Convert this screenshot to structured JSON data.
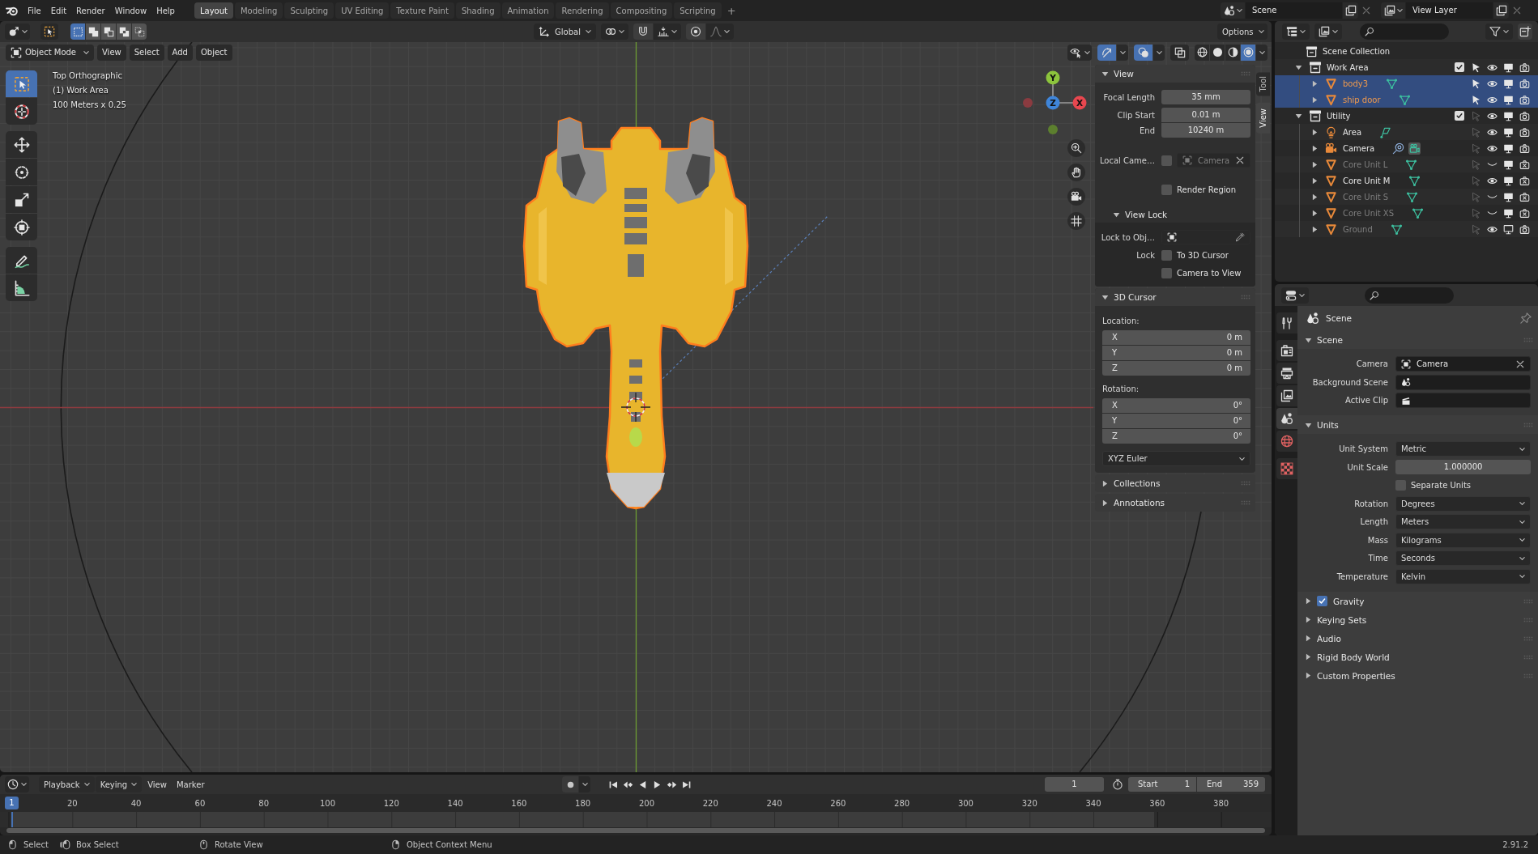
{
  "top_bar": {
    "menus": [
      "File",
      "Edit",
      "Render",
      "Window",
      "Help"
    ],
    "workspaces": [
      {
        "label": "Layout",
        "selected": true
      },
      {
        "label": "Modeling",
        "selected": false
      },
      {
        "label": "Sculpting",
        "selected": false
      },
      {
        "label": "UV Editing",
        "selected": false
      },
      {
        "label": "Texture Paint",
        "selected": false
      },
      {
        "label": "Shading",
        "selected": false
      },
      {
        "label": "Animation",
        "selected": false
      },
      {
        "label": "Rendering",
        "selected": false
      },
      {
        "label": "Compositing",
        "selected": false
      },
      {
        "label": "Scripting",
        "selected": false
      }
    ],
    "add_workspace": "+",
    "scene": "Scene",
    "view_layer": "View Layer"
  },
  "tool_header": {
    "select_modes": [
      {
        "kind": "new",
        "selected": true
      },
      {
        "kind": "extend",
        "selected": false
      },
      {
        "kind": "subtract",
        "selected": false
      },
      {
        "kind": "invert",
        "selected": false
      },
      {
        "kind": "intersect",
        "selected": false
      }
    ],
    "orientation": "Global",
    "options": "Options"
  },
  "viewport_header": {
    "mode": "Object Mode",
    "menus": [
      "View",
      "Select",
      "Add",
      "Object"
    ],
    "toggles": [
      {
        "kind": "gizmo",
        "on": true
      },
      {
        "kind": "overlays",
        "on": true
      },
      {
        "kind": "xray",
        "on": false
      }
    ],
    "shading": [
      {
        "kind": "wireframe",
        "selected": false
      },
      {
        "kind": "solid",
        "selected": false
      },
      {
        "kind": "material",
        "selected": false
      },
      {
        "kind": "rendered",
        "selected": true
      }
    ]
  },
  "viewport": {
    "view_name": "Top Orthographic",
    "collection": "(1) Work Area",
    "grid_scale": "100 Meters x 0.25",
    "tool_groups": [
      [
        {
          "kind": "select",
          "selected": true
        },
        {
          "kind": "cursor",
          "selected": false
        }
      ],
      [
        {
          "kind": "move",
          "selected": false
        },
        {
          "kind": "rotate",
          "selected": false
        },
        {
          "kind": "scale",
          "selected": false
        },
        {
          "kind": "transform",
          "selected": false
        }
      ],
      [
        {
          "kind": "annotate",
          "selected": false
        },
        {
          "kind": "measure",
          "selected": false
        }
      ]
    ],
    "axes": [
      {
        "label": "Y",
        "color": "#8cc43c"
      },
      {
        "label": "Z",
        "color": "#3f85d9"
      },
      {
        "label": "X",
        "color": "#e8474f"
      }
    ]
  },
  "sidebar": {
    "tabs": [
      {
        "label": "Tool",
        "selected": false
      },
      {
        "label": "View",
        "selected": true
      }
    ],
    "view_panel": {
      "title": "View",
      "expanded": true,
      "fields": [
        {
          "label": "Focal Length",
          "value": "35 mm"
        },
        {
          "label": "Clip Start",
          "value": "0.01 m"
        },
        {
          "label": "End",
          "value": "10240 m"
        }
      ],
      "local_camera": {
        "label": "Local Came…",
        "checked": false,
        "value": "Camera"
      },
      "render_region": {
        "label": "Render Region",
        "checked": false
      },
      "view_lock": {
        "title": "View Lock",
        "expanded": true,
        "lock_object_label": "Lock to Obj…",
        "lock_label": "Lock",
        "options": [
          {
            "label": "To 3D Cursor",
            "checked": false
          },
          {
            "label": "Camera to View",
            "checked": false
          }
        ]
      }
    },
    "cursor_panel": {
      "title": "3D Cursor",
      "expanded": true,
      "location_label": "Location:",
      "location": [
        {
          "axis": "X",
          "value": "0 m"
        },
        {
          "axis": "Y",
          "value": "0 m"
        },
        {
          "axis": "Z",
          "value": "0 m"
        }
      ],
      "rotation_label": "Rotation:",
      "rotation": [
        {
          "axis": "X",
          "value": "0°"
        },
        {
          "axis": "Y",
          "value": "0°"
        },
        {
          "axis": "Z",
          "value": "0°"
        }
      ],
      "rotation_mode": "XYZ Euler"
    },
    "other_panels": [
      {
        "title": "Collections",
        "expanded": false
      },
      {
        "title": "Annotations",
        "expanded": false
      }
    ]
  },
  "outliner": {
    "root": "Scene Collection",
    "collections": [
      {
        "name": "Work Area",
        "expanded": true,
        "selected": false,
        "checked": true,
        "selectable": true,
        "visible": true,
        "viewport": true,
        "render": true,
        "children": [
          {
            "name": "body3",
            "kind": "mesh",
            "expanded": false,
            "selected": true,
            "selectable": true,
            "visible": true,
            "viewport": true,
            "render": true
          },
          {
            "name": "ship door",
            "kind": "mesh",
            "expanded": false,
            "selected": true,
            "selectable": true,
            "visible": true,
            "viewport": true,
            "render": true
          }
        ]
      },
      {
        "name": "Utility",
        "expanded": true,
        "selected": false,
        "checked": true,
        "selectable": false,
        "visible": true,
        "viewport": true,
        "render": true,
        "children": [
          {
            "name": "Area",
            "kind": "light",
            "expanded": false,
            "selected": false,
            "selectable": false,
            "visible": true,
            "viewport": true,
            "render": true
          },
          {
            "name": "Camera",
            "kind": "camera",
            "expanded": false,
            "selected": false,
            "selectable": false,
            "visible": true,
            "viewport": true,
            "render": true
          },
          {
            "name": "Core Unit L",
            "kind": "mesh",
            "expanded": false,
            "selected": false,
            "selectable": false,
            "visible": false,
            "viewport": true,
            "render": false
          },
          {
            "name": "Core Unit M",
            "kind": "mesh",
            "expanded": false,
            "selected": false,
            "selectable": false,
            "visible": true,
            "viewport": true,
            "render": false
          },
          {
            "name": "Core Unit S",
            "kind": "mesh",
            "expanded": false,
            "selected": false,
            "selectable": false,
            "visible": false,
            "viewport": true,
            "render": false
          },
          {
            "name": "Core Unit XS",
            "kind": "mesh",
            "expanded": false,
            "selected": false,
            "selectable": false,
            "visible": false,
            "viewport": true,
            "render": false
          },
          {
            "name": "Ground",
            "kind": "mesh",
            "expanded": false,
            "selected": false,
            "selectable": false,
            "visible": true,
            "viewport": false,
            "render": true
          }
        ]
      }
    ]
  },
  "properties": {
    "tab_groups": [
      [
        {
          "kind": "tool",
          "selected": false
        }
      ],
      [
        {
          "kind": "render",
          "selected": false
        },
        {
          "kind": "output",
          "selected": false
        },
        {
          "kind": "view_layer",
          "selected": false
        },
        {
          "kind": "scene",
          "selected": true
        },
        {
          "kind": "world",
          "selected": false
        }
      ],
      [
        {
          "kind": "texture",
          "selected": false
        }
      ]
    ],
    "context": "Scene",
    "panels": [
      {
        "title": "Scene",
        "kind": "plain",
        "expanded": true,
        "rows": [
          {
            "kind": "object",
            "label": "Camera",
            "value": "Camera"
          },
          {
            "kind": "scene",
            "label": "Background Scene"
          },
          {
            "kind": "clip",
            "label": "Active Clip"
          }
        ]
      },
      {
        "title": "Units",
        "kind": "plain",
        "expanded": true,
        "rows": [
          {
            "kind": "dropdown",
            "label": "Unit System",
            "value": "Metric"
          },
          {
            "kind": "number",
            "label": "Unit Scale",
            "value": "1.000000"
          },
          {
            "kind": "checkbox",
            "label": "Separate Units",
            "checked": false
          },
          {
            "kind": "dropdown",
            "label": "Rotation",
            "value": "Degrees"
          },
          {
            "kind": "dropdown",
            "label": "Length",
            "value": "Meters"
          },
          {
            "kind": "dropdown",
            "label": "Mass",
            "value": "Kilograms"
          },
          {
            "kind": "dropdown",
            "label": "Time",
            "value": "Seconds"
          },
          {
            "kind": "dropdown",
            "label": "Temperature",
            "value": "Kelvin"
          }
        ]
      },
      {
        "title": "Gravity",
        "kind": "toggle",
        "checked": true,
        "expanded": false
      },
      {
        "title": "Keying Sets",
        "kind": "plain",
        "expanded": false
      },
      {
        "title": "Audio",
        "kind": "plain",
        "expanded": false
      },
      {
        "title": "Rigid Body World",
        "kind": "plain",
        "expanded": false
      },
      {
        "title": "Custom Properties",
        "kind": "plain",
        "expanded": false
      }
    ]
  },
  "timeline": {
    "menus": [
      {
        "label": "Playback",
        "dropdown": true
      },
      {
        "label": "Keying",
        "dropdown": true
      },
      {
        "label": "View",
        "dropdown": false
      },
      {
        "label": "Marker",
        "dropdown": false
      }
    ],
    "current_frame": "1",
    "start_label": "Start",
    "start": "1",
    "end_label": "End",
    "end": "359",
    "playhead": "1",
    "ruler": [
      "20",
      "40",
      "60",
      "80",
      "100",
      "120",
      "140",
      "160",
      "180",
      "200",
      "220",
      "240",
      "260",
      "280",
      "300",
      "320",
      "340",
      "360",
      "380"
    ]
  },
  "status_bar": {
    "hints": [
      {
        "kind": "left",
        "label": "Select"
      },
      {
        "kind": "drag",
        "label": "Box Select"
      },
      {
        "kind": "middle",
        "label": "Rotate View"
      },
      {
        "kind": "right",
        "label": "Object Context Menu"
      }
    ],
    "version": "2.91.2"
  }
}
